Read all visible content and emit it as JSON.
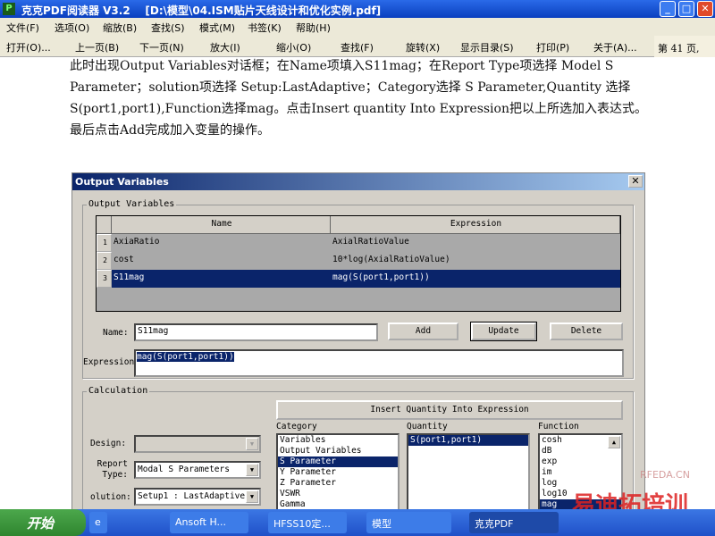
{
  "window": {
    "title": "克克PDF阅读器 V3.2    [D:\\模型\\04.ISM贴片天线设计和优化实例.pdf]"
  },
  "menu": [
    "文件(F)",
    "选项(O)",
    "缩放(B)",
    "查找(S)",
    "模式(M)",
    "书签(K)",
    "帮助(H)"
  ],
  "toolbar": [
    "打开(O)...",
    "上一页(B)",
    "下一页(N)",
    "放大(I)",
    "缩小(O)",
    "查找(F)",
    "旋转(X)",
    "显示目录(S)",
    "打印(P)",
    "关于(A)..."
  ],
  "page_indicator": "第 41 页,",
  "doc_lines": [
    "此时出现Output Variables对话框；在Name项填入S11mag；在Report Type项选择  Model S",
    "Parameter；solution项选择  Setup:LastAdaptive；Category选择  S  Parameter,Quantity  选择",
    "S(port1,port1),Function选择mag。点击Insert quantity Into Expression把以上所选加入表达式。",
    "最后点击Add完成加入变量的操作。"
  ],
  "dialog": {
    "title": "Output Variables",
    "group1": "Output Variables",
    "columns": [
      "Name",
      "Expression"
    ],
    "rows": [
      {
        "num": "1",
        "name": "AxiaRatio",
        "expr": "AxialRatioValue"
      },
      {
        "num": "2",
        "name": "cost",
        "expr": "10*log(AxialRatioValue)"
      },
      {
        "num": "3",
        "name": "S11mag",
        "expr": "mag(S(port1,port1))"
      }
    ],
    "name_label": "Name:",
    "name_value": "S11mag",
    "add": "Add",
    "update": "Update",
    "delete": "Delete",
    "expr_label": "Expression",
    "expr_value": "mag(S(port1,port1))",
    "group2": "Calculation",
    "insert": "Insert Quantity Into Expression",
    "category_label": "Category",
    "quantity_label": "Quantity",
    "function_label": "Function",
    "categories": [
      "Variables",
      "Output Variables",
      "S Parameter",
      "Y Parameter",
      "Z Parameter",
      "VSWR",
      "Gamma"
    ],
    "quantities": [
      "S(port1,port1)"
    ],
    "functions": [
      "cosh",
      "dB",
      "exp",
      "im",
      "log",
      "log10",
      "mag"
    ],
    "design_label": "Design:",
    "design_value": "",
    "report_label": "Report Type:",
    "report_value": "Modal S Parameters",
    "solution_label": "olution:",
    "solution_value": "Setup1 : LastAdaptive"
  },
  "taskbar": {
    "start": "开始",
    "items": [
      "",
      "Ansoft H...",
      "HFSS10定...",
      "模型",
      "克克PDF"
    ]
  },
  "watermark": {
    "text": "易迪拓培训",
    "site": "RFEDA.CN"
  }
}
